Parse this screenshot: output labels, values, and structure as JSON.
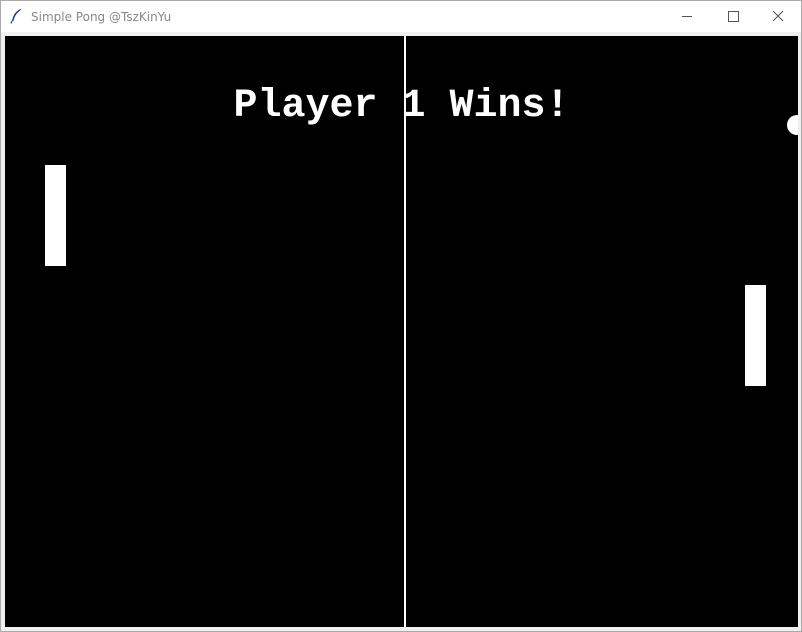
{
  "window": {
    "title": "Simple Pong @TszKinYu",
    "icon": "feather-icon",
    "controls": [
      "minimize-icon",
      "maximize-icon",
      "close-icon"
    ]
  },
  "game": {
    "message": "Player 1 Wins!",
    "colors": {
      "background": "#000000",
      "foreground": "#ffffff"
    }
  }
}
